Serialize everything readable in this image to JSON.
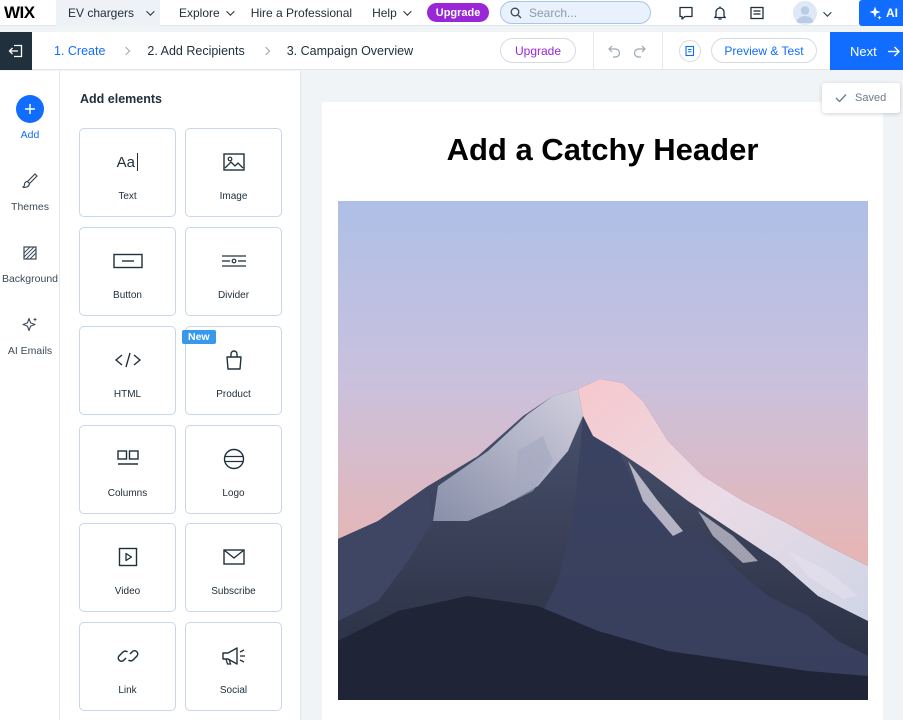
{
  "topbar": {
    "logo": "WIX",
    "site_name": "EV chargers",
    "nav": [
      {
        "label": "Explore",
        "has_dropdown": true
      },
      {
        "label": "Hire a Professional",
        "has_dropdown": false
      },
      {
        "label": "Help",
        "has_dropdown": true
      }
    ],
    "upgrade_label": "Upgrade",
    "search_placeholder": "Search...",
    "ai_label": "AI",
    "icons": [
      "chat-icon",
      "bell-icon",
      "dashboard-icon",
      "avatar-icon",
      "sparkle-icon"
    ]
  },
  "stepbar": {
    "steps": [
      {
        "label": "1. Create",
        "active": true
      },
      {
        "label": "2. Add Recipients",
        "active": false
      },
      {
        "label": "3. Campaign Overview",
        "active": false
      }
    ],
    "upgrade_label": "Upgrade",
    "preview_label": "Preview & Test",
    "next_label": "Next"
  },
  "rail": {
    "items": [
      {
        "label": "Add",
        "icon": "plus-icon",
        "active": true
      },
      {
        "label": "Themes",
        "icon": "brush-icon",
        "active": false
      },
      {
        "label": "Background",
        "icon": "hatch-icon",
        "active": false
      },
      {
        "label": "AI Emails",
        "icon": "sparkle-icon",
        "active": false
      }
    ]
  },
  "panel": {
    "title": "Add elements",
    "new_badge": "New",
    "tiles": [
      {
        "label": "Text",
        "icon": "text-icon"
      },
      {
        "label": "Image",
        "icon": "image-icon"
      },
      {
        "label": "Button",
        "icon": "button-icon"
      },
      {
        "label": "Divider",
        "icon": "divider-icon"
      },
      {
        "label": "HTML",
        "icon": "code-icon"
      },
      {
        "label": "Product",
        "icon": "bag-icon"
      },
      {
        "label": "Columns",
        "icon": "columns-icon"
      },
      {
        "label": "Logo",
        "icon": "logo-icon"
      },
      {
        "label": "Video",
        "icon": "video-icon"
      },
      {
        "label": "Subscribe",
        "icon": "envelope-icon"
      },
      {
        "label": "Link",
        "icon": "link-icon"
      },
      {
        "label": "Social",
        "icon": "megaphone-icon"
      }
    ],
    "text_icon_glyph": "Aa"
  },
  "canvas": {
    "header": "Add a Catchy Header",
    "image_alt": "Snowy mountain peak at dusk",
    "saved_label": "Saved"
  },
  "colors": {
    "accent": "#116dff",
    "upgrade": "#9a27d5",
    "dark": "#20303c",
    "new_badge": "#3899ec"
  }
}
